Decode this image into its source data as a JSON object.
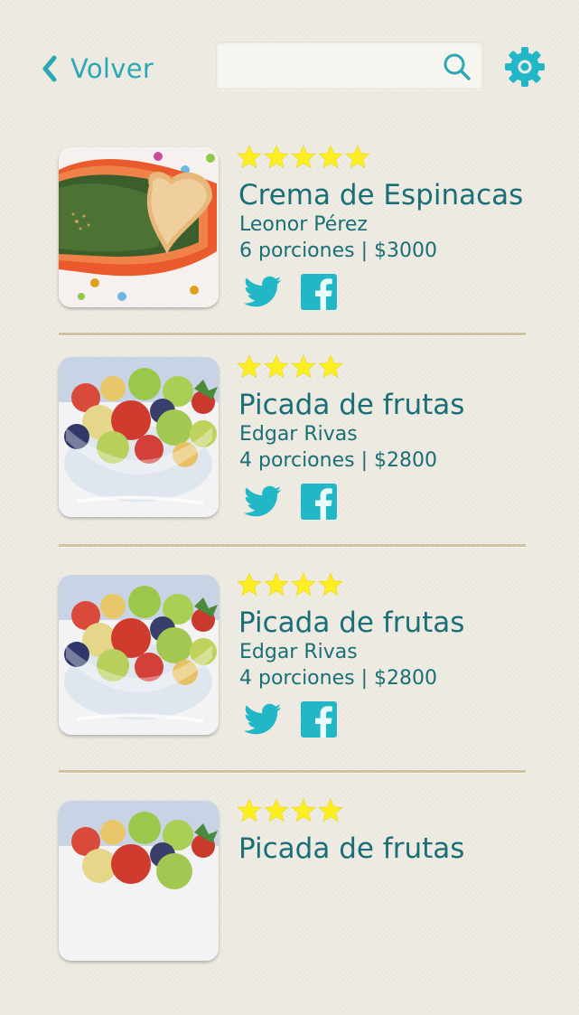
{
  "header": {
    "back_label": "Volver",
    "search_placeholder": "",
    "search_value": ""
  },
  "colors": {
    "accent": "#2aa9b4",
    "text": "#1a6f77",
    "star": "#fcee21",
    "divider": "#cfc3a2"
  },
  "recipes": [
    {
      "title": "Crema de Espinacas",
      "author": "Leonor Pérez",
      "meta": "6 porciones | $3000",
      "rating": 5,
      "image": "spinach-soup"
    },
    {
      "title": "Picada de frutas",
      "author": "Edgar Rivas",
      "meta": "4 porciones | $2800",
      "rating": 4,
      "image": "fruit-salad"
    },
    {
      "title": "Picada de frutas",
      "author": "Edgar Rivas",
      "meta": "4 porciones | $2800",
      "rating": 4,
      "image": "fruit-salad"
    },
    {
      "title": "Picada de frutas",
      "author": "",
      "meta": "",
      "rating": 4,
      "image": "fruit-salad"
    }
  ],
  "icons": {
    "back": "chevron-left-icon",
    "search": "search-icon",
    "settings": "gear-icon",
    "twitter": "twitter-icon",
    "facebook": "facebook-icon",
    "star": "star-icon"
  }
}
